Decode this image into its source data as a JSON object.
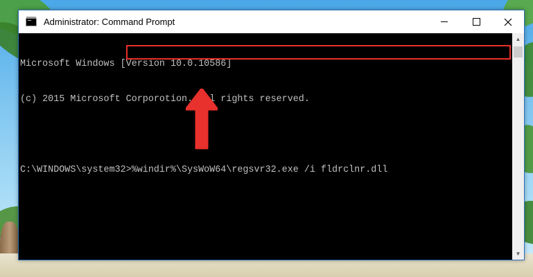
{
  "window": {
    "title": "Administrator: Command Prompt"
  },
  "console": {
    "line1": "Microsoft Windows [Version 10.0.10586]",
    "line2": "(c) 2015 Microsoft Corporotion. All rights reserved.",
    "prompt": "C:\\WINDOWS\\system32>",
    "command": "%windir%\\SysWoW64\\regsvr32.exe /i fldrclnr.dll"
  },
  "icons": {
    "app": "command-prompt-icon",
    "minimize": "minimize-icon",
    "maximize": "maximize-icon",
    "close": "close-icon",
    "scroll_up": "chevron-up-icon",
    "scroll_down": "chevron-down-icon",
    "annotation": "red-arrow-icon"
  },
  "colors": {
    "console_bg": "#000000",
    "console_text": "#c0c0c0",
    "highlight": "#e8302c",
    "titlebar": "#ffffff"
  }
}
